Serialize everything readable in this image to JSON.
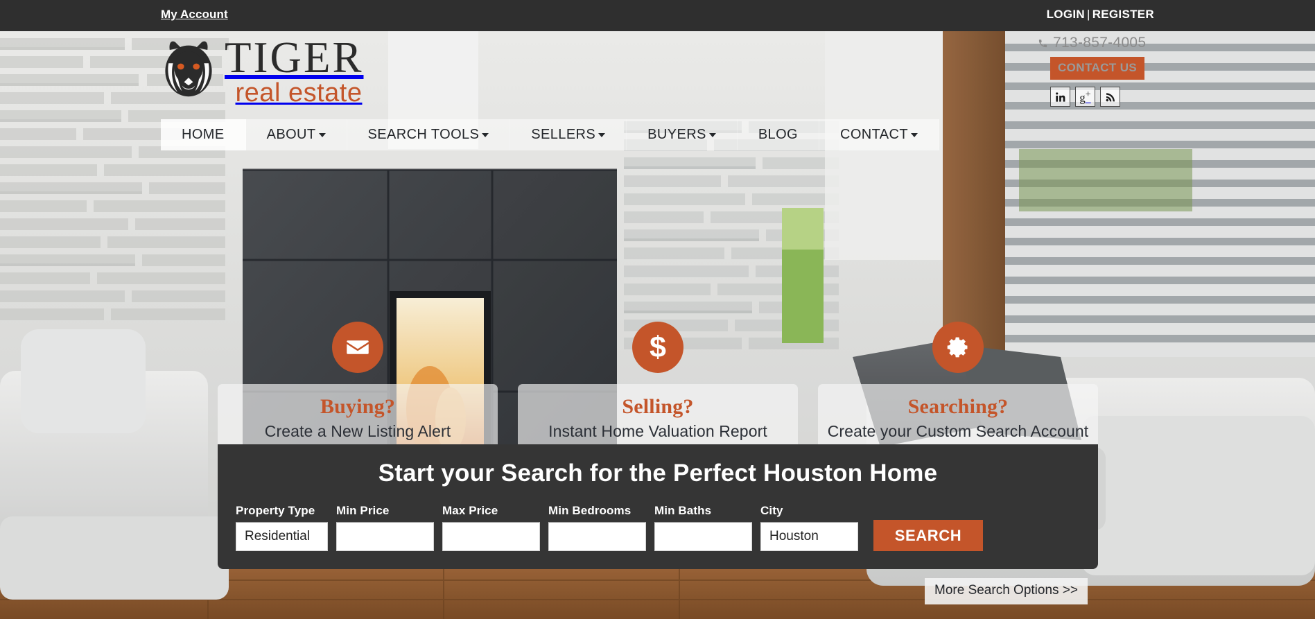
{
  "topbar": {
    "my_account": "My Account",
    "login": "LOGIN",
    "separator": "|",
    "register": "REGISTER"
  },
  "brand": {
    "name_primary": "TIGER",
    "name_secondary": "real estate",
    "logo_icon": "tiger-head-icon"
  },
  "contact": {
    "phone": "713-857-4005",
    "phone_icon": "phone-icon",
    "contact_button": "CONTACT US",
    "social": [
      {
        "name": "linkedin",
        "icon": "linkedin-icon",
        "glyph": "in"
      },
      {
        "name": "googleplus",
        "icon": "google-plus-icon",
        "glyph": "g+"
      },
      {
        "name": "rss",
        "icon": "rss-icon",
        "glyph": "rss"
      }
    ]
  },
  "nav": {
    "items": [
      {
        "label": "HOME",
        "caret": false,
        "active": true
      },
      {
        "label": "ABOUT",
        "caret": true,
        "active": false
      },
      {
        "label": "SEARCH TOOLS",
        "caret": true,
        "active": false
      },
      {
        "label": "SELLERS",
        "caret": true,
        "active": false
      },
      {
        "label": "BUYERS",
        "caret": true,
        "active": false
      },
      {
        "label": "BLOG",
        "caret": false,
        "active": false
      },
      {
        "label": "CONTACT",
        "caret": true,
        "active": false
      }
    ]
  },
  "promos": [
    {
      "icon": "envelope-icon",
      "heading": "Buying?",
      "subtitle": "Create a New Listing Alert"
    },
    {
      "icon": "dollar-icon",
      "heading": "Selling?",
      "subtitle": "Instant Home Valuation Report"
    },
    {
      "icon": "gear-icon",
      "heading": "Searching?",
      "subtitle": "Create your Custom Search Account"
    }
  ],
  "search": {
    "title": "Start your Search for the Perfect Houston Home",
    "fields": [
      {
        "label": "Property Type",
        "value": "Residential"
      },
      {
        "label": "Min Price",
        "value": ""
      },
      {
        "label": "Max Price",
        "value": ""
      },
      {
        "label": "Min Bedrooms",
        "value": ""
      },
      {
        "label": "Min Baths",
        "value": ""
      },
      {
        "label": "City",
        "value": "Houston"
      }
    ],
    "search_button": "SEARCH",
    "more_options": "More Search Options >>"
  },
  "colors": {
    "accent_orange": "#c4552a",
    "dark_bar": "#2f2f2f",
    "panel_dark": "#353535",
    "heading_text": "#ffffff",
    "body_text": "#2b2f36"
  }
}
